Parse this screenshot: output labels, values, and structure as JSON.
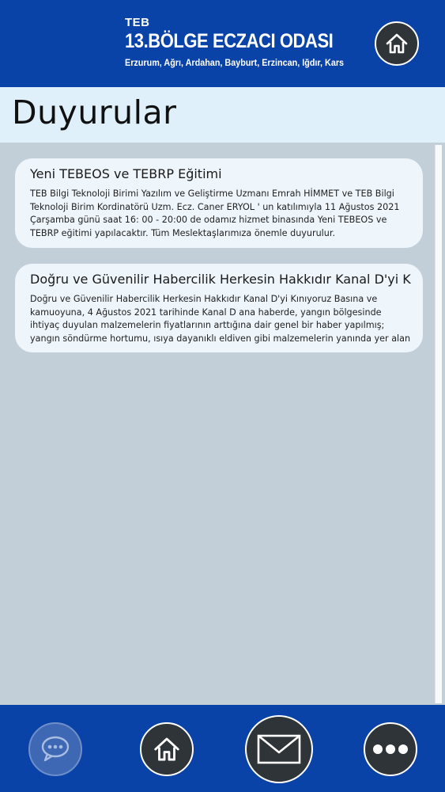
{
  "header": {
    "org_small": "TEB",
    "org_title": "13.BÖLGE ECZACI ODASI",
    "org_sub": "Erzurum, Ağrı, Ardahan, Bayburt, Erzincan, Iğdır, Kars",
    "home_icon": "home-icon"
  },
  "page": {
    "title": "Duyurular"
  },
  "announcements": [
    {
      "title": "Yeni TEBEOS ve TEBRP Eğitimi",
      "body": "TEB Bilgi Teknoloji Birimi Yazılım ve Geliştirme Uzmanı Emrah HİMMET ve TEB Bilgi Teknoloji Birim Kordinatörü Uzm. Ecz. Caner ERYOL ' un katılımıyla 11 Ağustos 2021 Çarşamba günü saat 16: 00 - 20:00 de odamız hizmet binasında Yeni TEBEOS ve TEBRP eğitimi yapılacaktır.   Tüm Meslektaşlarımıza önemle duyurulur."
    },
    {
      "title": "Doğru ve Güvenilir Habercilik Herkesin Hakkıdır Kanal D'yi Kınıyoruz",
      "body": "Doğru ve Güvenilir Habercilik Herkesin Hakkıdır  Kanal D'yi Kınıyoruz  Basına ve kamuoyuna,  4 Ağustos 2021 tarihinde Kanal D ana haberde, yangın bölgesinde ihtiyaç duyulan malzemelerin fiyatlarının arttığına dair genel bir haber yapılmış; yangın söndürme hortumu, ısıya dayanıklı eldiven gibi malzemelerin yanında yer alan"
    }
  ],
  "bottom_nav": {
    "chat_icon": "chat-bubble-icon",
    "home_icon": "home-icon",
    "mail_icon": "mail-icon",
    "more_icon": "more-dots-icon"
  },
  "colors": {
    "brand_blue": "#0a43a8",
    "title_bar": "#dff0fb",
    "content_bg": "#c2cfd9",
    "card_bg": "#eef5fb",
    "nav_button": "#2f3438"
  }
}
